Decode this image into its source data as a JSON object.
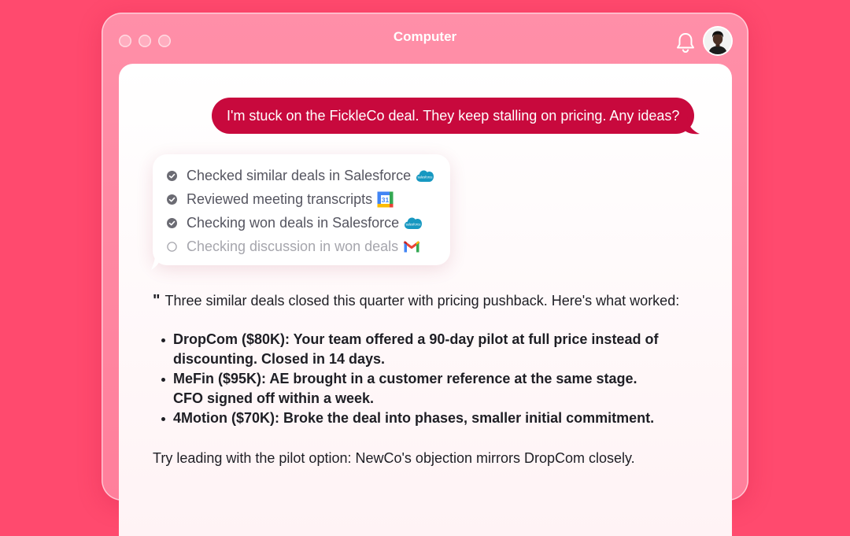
{
  "window": {
    "title": "Computer"
  },
  "chat": {
    "user_message": "I'm stuck on the FickleCo deal. They keep stalling on pricing. Any ideas?"
  },
  "steps": [
    {
      "label": "Checked similar deals in Salesforce",
      "status": "done",
      "app_icon": "salesforce-icon"
    },
    {
      "label": "Reviewed meeting transcripts",
      "status": "done",
      "app_icon": "google-calendar-icon"
    },
    {
      "label": "Checking won deals in Salesforce",
      "status": "done",
      "app_icon": "salesforce-icon"
    },
    {
      "label": "Checking discussion in won deals",
      "status": "pending",
      "app_icon": "gmail-icon"
    }
  ],
  "salesforce_icon_text": "salesforce",
  "calendar_icon_text": "31",
  "answer": {
    "quote_mark": "\"",
    "intro": "Three similar deals closed this quarter with pricing pushback. Here's what worked:",
    "bullets": [
      {
        "line1": "DropCom ($80K): Your team offered a 90-day pilot at full price instead of",
        "line2": "discounting. Closed in 14 days."
      },
      {
        "line1": "MeFin ($95K): AE brought in a customer reference at the same stage.",
        "line2": "CFO signed off within a week."
      },
      {
        "line1": "4Motion ($70K): Broke the deal into phases, smaller initial commitment.",
        "line2": ""
      }
    ],
    "closing": "Try leading with the pilot option: NewCo's objection mirrors DropCom closely."
  },
  "colors": {
    "background": "#ff4a6e",
    "user_bubble": "#c8093d",
    "salesforce": "#1798c1"
  }
}
